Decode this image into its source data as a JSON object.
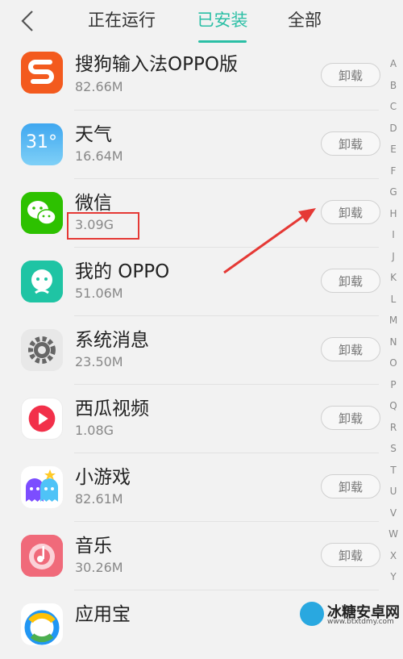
{
  "header": {
    "tabs": [
      {
        "label": "正在运行",
        "active": false
      },
      {
        "label": "已安装",
        "active": true
      },
      {
        "label": "全部",
        "active": false
      }
    ],
    "accent_color": "#2bbfa5"
  },
  "apps": [
    {
      "name": "搜狗输入法OPPO版",
      "size": "82.66M",
      "icon": "sogou-input-icon",
      "button": "卸载"
    },
    {
      "name": "天气",
      "size": "16.64M",
      "icon": "weather-icon",
      "icon_text": "31°",
      "button": "卸载"
    },
    {
      "name": "微信",
      "size": "3.09G",
      "icon": "wechat-icon",
      "button": "卸载"
    },
    {
      "name": "我的 OPPO",
      "size": "51.06M",
      "icon": "my-oppo-icon",
      "button": "卸载"
    },
    {
      "name": "系统消息",
      "size": "23.50M",
      "icon": "system-message-gear-icon",
      "button": "卸载"
    },
    {
      "name": "西瓜视频",
      "size": "1.08G",
      "icon": "xigua-video-icon",
      "button": "卸载"
    },
    {
      "name": "小游戏",
      "size": "82.61M",
      "icon": "mini-games-icon",
      "button": "卸载"
    },
    {
      "name": "音乐",
      "size": "30.26M",
      "icon": "music-icon",
      "button": "卸载"
    },
    {
      "name": "应用宝",
      "size": "",
      "icon": "app-store-icon",
      "button": ""
    }
  ],
  "alphabet": [
    "A",
    "B",
    "C",
    "D",
    "E",
    "F",
    "G",
    "H",
    "I",
    "J",
    "K",
    "L",
    "M",
    "N",
    "O",
    "P",
    "Q",
    "R",
    "S",
    "T",
    "U",
    "V",
    "W",
    "X",
    "Y"
  ],
  "watermark": {
    "text": "冰糖安卓网",
    "url": "www.btxtdmy.com"
  }
}
